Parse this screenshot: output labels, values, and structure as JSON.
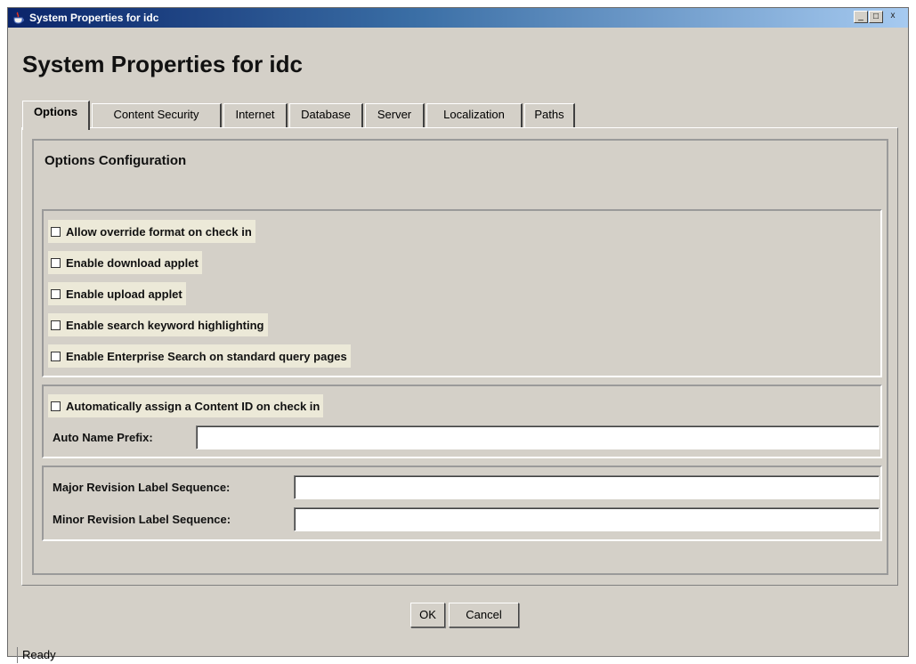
{
  "window": {
    "title": "System Properties for idc",
    "controls": {
      "minimize": "_",
      "maximize": "□",
      "close": "x"
    }
  },
  "heading": "System Properties for idc",
  "tabs": [
    {
      "label": "Options",
      "active": true
    },
    {
      "label": "Content Security",
      "active": false
    },
    {
      "label": "Internet",
      "active": false
    },
    {
      "label": "Database",
      "active": false
    },
    {
      "label": "Server",
      "active": false
    },
    {
      "label": "Localization",
      "active": false
    },
    {
      "label": "Paths",
      "active": false
    }
  ],
  "options": {
    "section_title": "Options Configuration",
    "checkboxes": [
      {
        "label": "Allow override format on check in",
        "checked": false
      },
      {
        "label": "Enable download applet",
        "checked": false
      },
      {
        "label": "Enable upload applet",
        "checked": false
      },
      {
        "label": "Enable search keyword highlighting",
        "checked": false
      },
      {
        "label": "Enable Enterprise Search on standard query pages",
        "checked": false
      }
    ],
    "auto_id": {
      "checkbox_label": "Automatically assign a Content ID on check in",
      "checked": false,
      "prefix_label": "Auto Name Prefix:",
      "prefix_value": ""
    },
    "revisions": {
      "major_label": "Major Revision Label Sequence:",
      "major_value": "",
      "minor_label": "Minor Revision Label Sequence:",
      "minor_value": ""
    }
  },
  "buttons": {
    "ok": "OK",
    "cancel": "Cancel"
  },
  "status": "Ready",
  "colors": {
    "window_bg": "#d4d0c8",
    "titlebar": "#0a246a"
  },
  "icons": {
    "app": "java-cup-icon"
  }
}
